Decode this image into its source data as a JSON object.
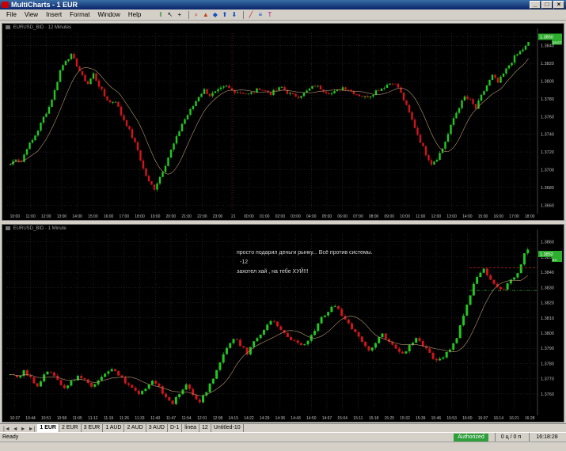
{
  "window": {
    "title": "MultiCharts - 1 EUR"
  },
  "menu": [
    "File",
    "View",
    "Insert",
    "Format",
    "Window",
    "Help"
  ],
  "toolbar": {
    "icons": [
      "bar-style-icon",
      "cursor-icon",
      "crosshair-icon",
      "zoom-icon",
      "indicator-icon",
      "pan-icon",
      "line-icon",
      "fib-icon",
      "text-icon"
    ]
  },
  "colors": {
    "up": "#22c722",
    "down": "#d0151c",
    "ma": "#b89a72",
    "grid": "#3a3a3a",
    "price_box": "#2eae2e",
    "dashed_red": "#b01c1c",
    "dashed_green": "#2ea02e"
  },
  "charts": [
    {
      "id": "chart1",
      "label": "EURUSD_BID · 12 Minutes",
      "chart_data": {
        "type": "candlestick",
        "ylim": [
          1.3654,
          1.3854
        ],
        "y_ticks": [
          "1.3850",
          "1.3840",
          "1.3820",
          "1.3800",
          "1.3780",
          "1.3760",
          "1.3740",
          "1.3720",
          "1.3700",
          "1.3680",
          "1.3660"
        ],
        "x_ticks": [
          "10:00",
          "11:00",
          "12:00",
          "13:00",
          "14:00",
          "15:00",
          "16:00",
          "17:00",
          "18:00",
          "19:00",
          "20:00",
          "21:00",
          "22:00",
          "23:00",
          "21",
          "00:00",
          "01:00",
          "02:00",
          "03:00",
          "04:00",
          "05:00",
          "06:00",
          "07:00",
          "08:00",
          "09:00",
          "10:00",
          "11:00",
          "12:00",
          "13:00",
          "14:00",
          "15:00",
          "16:00",
          "17:00",
          "18:00"
        ],
        "price_label": "1.3850",
        "price_sub": "20:57",
        "path": [
          1.3706,
          1.3713,
          1.3709,
          1.3725,
          1.3733,
          1.3745,
          1.3759,
          1.3771,
          1.3789,
          1.3812,
          1.3824,
          1.3829,
          1.3818,
          1.3805,
          1.3797,
          1.3808,
          1.3795,
          1.3783,
          1.3776,
          1.3778,
          1.3762,
          1.3751,
          1.3737,
          1.3722,
          1.3701,
          1.3686,
          1.3679,
          1.3692,
          1.3706,
          1.3722,
          1.3736,
          1.3752,
          1.3762,
          1.3772,
          1.3783,
          1.379,
          1.3784,
          1.3787,
          1.3791,
          1.3794,
          1.3789,
          1.3788,
          1.3787,
          1.3785,
          1.3788,
          1.3792,
          1.3789,
          1.3786,
          1.379,
          1.3793,
          1.3787,
          1.3784,
          1.3783,
          1.3786,
          1.3791,
          1.3795,
          1.3792,
          1.3788,
          1.3786,
          1.3789,
          1.3793,
          1.3791,
          1.3787,
          1.3784,
          1.3782,
          1.3784,
          1.3789,
          1.3792,
          1.3796,
          1.3799,
          1.3793,
          1.3779,
          1.3764,
          1.3748,
          1.3732,
          1.3718,
          1.3707,
          1.3713,
          1.3724,
          1.374,
          1.3758,
          1.3771,
          1.3782,
          1.3778,
          1.3769,
          1.3783,
          1.3795,
          1.3806,
          1.3798,
          1.3808,
          1.3818,
          1.3827,
          1.3833,
          1.3839,
          1.3847
        ]
      }
    },
    {
      "id": "chart2",
      "label": "EURUSD_BID · 1 Minute",
      "chart_data": {
        "type": "candlestick",
        "ylim": [
          1.3748,
          1.3865
        ],
        "y_ticks": [
          "1.3860",
          "1.3850",
          "1.3840",
          "1.3830",
          "1.3820",
          "1.3810",
          "1.3800",
          "1.3790",
          "1.3780",
          "1.3770",
          "1.3760"
        ],
        "x_ticks": [
          "10:37",
          "10:44",
          "10:51",
          "10:58",
          "11:05",
          "11:12",
          "11:19",
          "11:26",
          "11:33",
          "11:40",
          "11:47",
          "11:54",
          "12:01",
          "12:08",
          "14:15",
          "14:22",
          "14:29",
          "14:36",
          "14:43",
          "14:50",
          "14:57",
          "15:04",
          "15:11",
          "15:18",
          "15:25",
          "15:32",
          "15:39",
          "15:46",
          "15:53",
          "16:00",
          "16:07",
          "16:14",
          "16:21",
          "16:28"
        ],
        "price_label": "1.3852",
        "price_sub": "44",
        "path": [
          1.3774,
          1.3771,
          1.3775,
          1.377,
          1.3766,
          1.3772,
          1.3775,
          1.3769,
          1.3764,
          1.3768,
          1.3772,
          1.3769,
          1.3765,
          1.377,
          1.3774,
          1.3777,
          1.3772,
          1.3768,
          1.3764,
          1.376,
          1.3763,
          1.3768,
          1.3764,
          1.3758,
          1.3754,
          1.376,
          1.3766,
          1.376,
          1.3755,
          1.3761,
          1.3771,
          1.378,
          1.379,
          1.3797,
          1.3792,
          1.3787,
          1.3794,
          1.38,
          1.3806,
          1.3808,
          1.3802,
          1.3797,
          1.3794,
          1.3791,
          1.3795,
          1.3802,
          1.381,
          1.3815,
          1.3818,
          1.3812,
          1.3806,
          1.38,
          1.3794,
          1.3788,
          1.3793,
          1.38,
          1.3794,
          1.379,
          1.3786,
          1.3792,
          1.3797,
          1.3792,
          1.3786,
          1.3781,
          1.3783,
          1.379,
          1.3797,
          1.3812,
          1.3825,
          1.3838,
          1.3842,
          1.3836,
          1.3831,
          1.3829,
          1.3835,
          1.384,
          1.3852,
          1.386
        ]
      },
      "annotations": [
        "просто подарил деньги рынку... Всё против системы.",
        "-12",
        "захотел хай , на тебе ХУЙ!!!"
      ],
      "levels": {
        "red_dashed": 1.3843,
        "green_dashdot": 1.3828
      }
    }
  ],
  "tabs": [
    {
      "label": "1 EUR",
      "active": true
    },
    {
      "label": "2 EUR",
      "active": false
    },
    {
      "label": "3 EUR",
      "active": false
    },
    {
      "label": "1 AUD",
      "active": false
    },
    {
      "label": "2 AUD",
      "active": false
    },
    {
      "label": "3 AUD",
      "active": false
    },
    {
      "label": "D-1",
      "active": false
    },
    {
      "label": "linea",
      "active": false
    },
    {
      "label": "12",
      "active": false
    },
    {
      "label": "Untitled-10",
      "active": false
    }
  ],
  "status": {
    "ready": "Ready",
    "authorized": "Authorized",
    "counter": "0 ц / 0 п",
    "clock": "16:18:28"
  }
}
